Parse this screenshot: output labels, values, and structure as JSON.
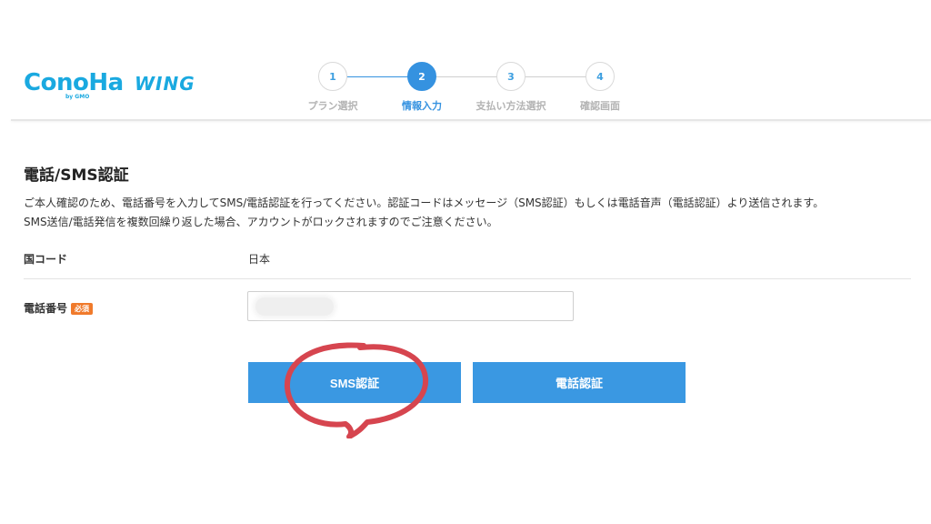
{
  "header": {
    "logo_main": "ConoHa",
    "logo_sub": "by GMO",
    "logo_product": "WING"
  },
  "stepper": {
    "steps": [
      {
        "number": "1",
        "label": "プラン選択",
        "state": "done"
      },
      {
        "number": "2",
        "label": "情報入力",
        "state": "active"
      },
      {
        "number": "3",
        "label": "支払い方法選択",
        "state": "upcoming"
      },
      {
        "number": "4",
        "label": "確認画面",
        "state": "upcoming"
      }
    ]
  },
  "main": {
    "title": "電話/SMS認証",
    "description_line1": "ご本人確認のため、電話番号を入力してSMS/電話認証を行ってください。認証コードはメッセージ（SMS認証）もしくは電話音声（電話認証）より送信されます。",
    "description_line2": "SMS送信/電話発信を複数回繰り返した場合、アカウントがロックされますのでご注意ください。",
    "country_code_label": "国コード",
    "country_code_value": "日本",
    "phone_label": "電話番号",
    "required_badge": "必須",
    "phone_value": "",
    "sms_button": "SMS認証",
    "phone_button": "電話認証"
  },
  "colors": {
    "brand": "#1aa9e0",
    "primary_button": "#3a98e2",
    "required_badge": "#f07a2b",
    "highlight_annotation": "#d6454f"
  }
}
